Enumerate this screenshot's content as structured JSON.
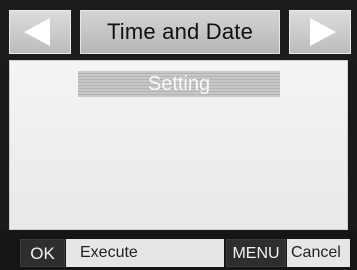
{
  "header": {
    "title": "Time and Date",
    "prev_icon": "left-arrow-icon",
    "next_icon": "right-arrow-icon"
  },
  "menu": {
    "selected_item": "Setting"
  },
  "footer": {
    "ok_key": "OK",
    "ok_action": "Execute",
    "menu_key": "MENU",
    "menu_action": "Cancel"
  },
  "colors": {
    "background": "#1a1a1a",
    "panel": "#efefef",
    "highlight": "#bebebe"
  }
}
